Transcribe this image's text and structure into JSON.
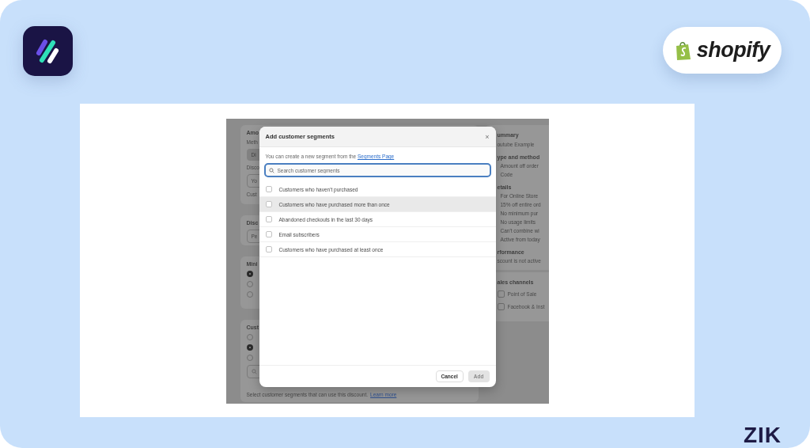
{
  "shopify_badge": {
    "label": "shopify"
  },
  "corner_mark": "ZIK",
  "screenshot": {
    "left_cards": [
      {
        "items": [
          {
            "kind": "title",
            "text": "Amo"
          },
          {
            "kind": "label",
            "text": "Meth"
          },
          {
            "kind": "button",
            "text": "Di"
          },
          {
            "kind": "label",
            "text": "Disco"
          },
          {
            "kind": "field",
            "text": "Yo"
          },
          {
            "kind": "label",
            "text": "Cust"
          }
        ]
      },
      {
        "items": [
          {
            "kind": "title",
            "text": "Disc"
          },
          {
            "kind": "field",
            "text": "Pe"
          }
        ]
      },
      {
        "items": [
          {
            "kind": "title",
            "text": "Mini"
          },
          {
            "kind": "radio",
            "selected": true
          },
          {
            "kind": "radio",
            "selected": false
          },
          {
            "kind": "radio",
            "selected": false
          }
        ]
      },
      {
        "items": [
          {
            "kind": "title",
            "text": "Cust"
          },
          {
            "kind": "radio",
            "selected": false
          },
          {
            "kind": "radio",
            "selected": true
          },
          {
            "kind": "radio",
            "selected": false
          },
          {
            "kind": "search"
          },
          {
            "kind": "note",
            "text": "Select customer segments that can use this discount.",
            "link": "Learn more"
          }
        ]
      }
    ],
    "summary": {
      "title": "ummary",
      "name": "outube Example",
      "sections": [
        {
          "heading": "ype and method",
          "items": [
            "Amount off order",
            "Code"
          ]
        },
        {
          "heading": "etails",
          "items": [
            "For Online Store",
            "15% off entire ord",
            "No minimum pur",
            "No usage limits",
            "Can't combine wi",
            "Active from today"
          ]
        },
        {
          "heading": "rformance",
          "text": "scount is not active"
        }
      ]
    },
    "sales_channels": {
      "title": "ales channels",
      "items": [
        {
          "label": "Point of Sale",
          "checked": false
        },
        {
          "label": "Facebook & Inst",
          "checked": false
        }
      ]
    }
  },
  "dialog": {
    "title": "Add customer segments",
    "close": "×",
    "intro": "You can create a new segment from the",
    "intro_link": "Segments Page",
    "search": {
      "placeholder": "Search customer segments"
    },
    "segments": [
      {
        "label": "Customers who haven't purchased",
        "checked": false,
        "hovered": false
      },
      {
        "label": "Customers who have purchased more than once",
        "checked": false,
        "hovered": true
      },
      {
        "label": "Abandoned checkouts in the last 30 days",
        "checked": false,
        "hovered": false
      },
      {
        "label": "Email subscribers",
        "checked": false,
        "hovered": false
      },
      {
        "label": "Customers who have purchased at least once",
        "checked": false,
        "hovered": false
      }
    ],
    "buttons": [
      {
        "label": "Cancel",
        "kind": "secondary",
        "disabled": false
      },
      {
        "label": "Add",
        "kind": "primary",
        "disabled": true
      }
    ]
  }
}
